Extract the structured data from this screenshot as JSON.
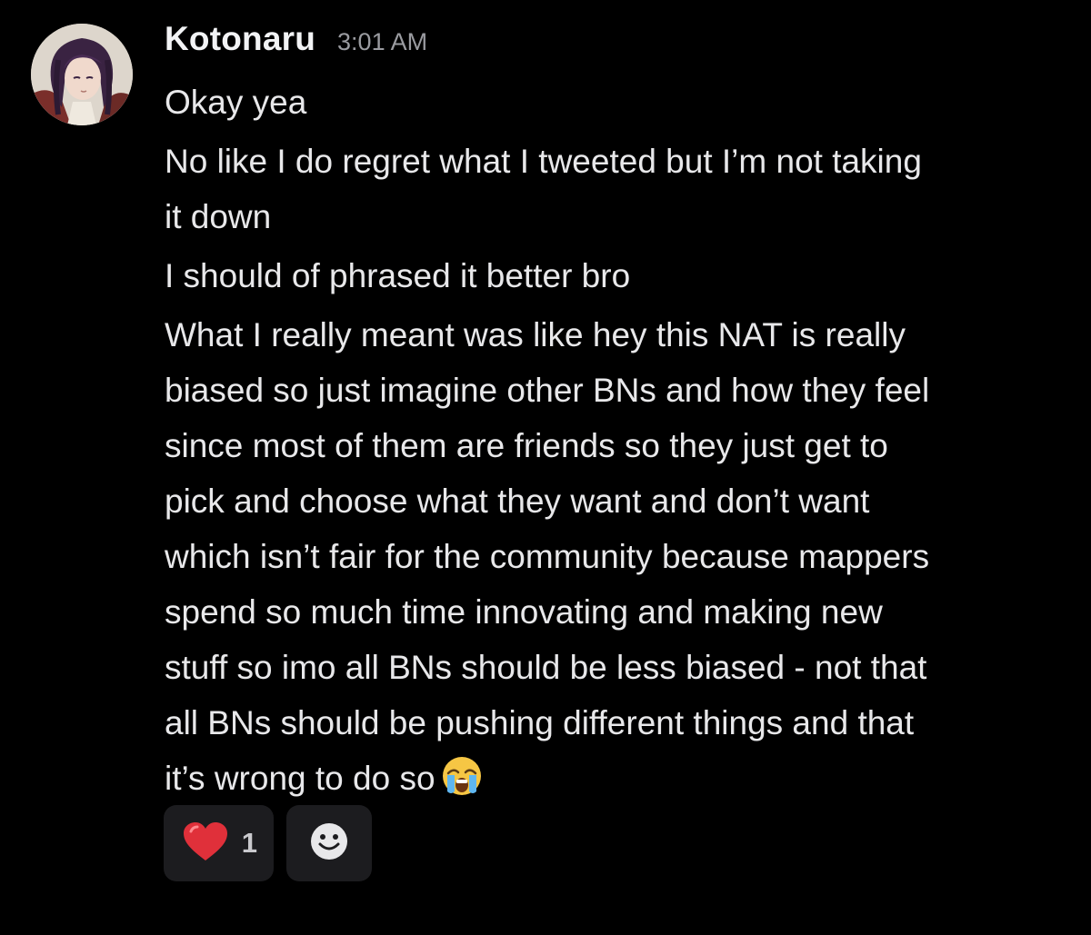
{
  "message": {
    "author": "Kotonaru",
    "timestamp": "3:01 AM",
    "lines": [
      "Okay yea",
      "No like I do regret what I tweeted but I’m not taking\nit down",
      "I should of phrased it better bro",
      "What I really meant was like hey this NAT is really\nbiased so just imagine other BNs and how they feel\nsince most of them are friends so they just get to\npick and choose what they want and don’t want\nwhich isn’t fair for the community because mappers\nspend so much time innovating and making new\nstuff so imo all BNs should be less biased - not that\nall BNs should be pushing different things and that\nit’s wrong to do so"
    ],
    "trailing_emoji": "loudly-crying-face-emoji"
  },
  "reactions": [
    {
      "emoji": "red-heart-emoji",
      "count": "1"
    },
    {
      "emoji": "add-reaction-smiley-icon"
    }
  ],
  "colors": {
    "background": "#000000",
    "author": "#f2f3f5",
    "timestamp": "#9a9ba0",
    "body_text": "#e8e8ea",
    "reaction_bg": "#1c1c1f",
    "heart": "#e0303a"
  }
}
